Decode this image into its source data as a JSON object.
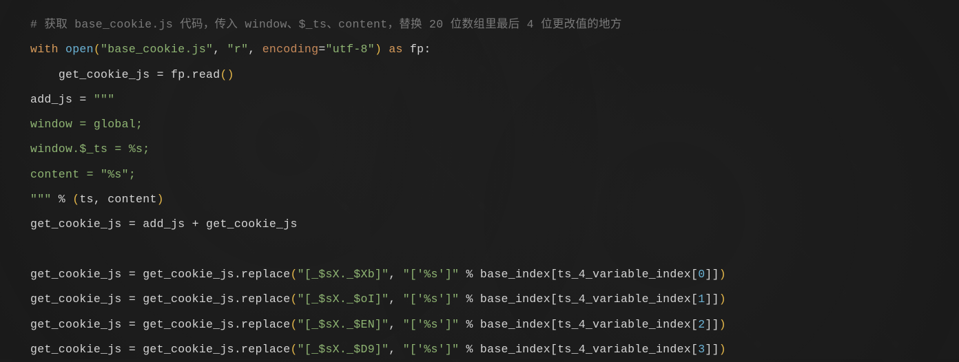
{
  "code": {
    "line1": {
      "comment": "# 获取 base_cookie.js 代码，传入 window、$_ts、content，替换 20 位数组里最后 4 位更改值的地方"
    },
    "line2": {
      "with": "with",
      "open": "open",
      "lparen": "(",
      "arg1": "\"base_cookie.js\"",
      "comma1": ", ",
      "arg2": "\"r\"",
      "comma2": ", ",
      "encparam": "encoding",
      "eq": "=",
      "encval": "\"utf-8\"",
      "rparen": ")",
      "as": " as ",
      "fp": "fp:"
    },
    "line3": {
      "indent": "    ",
      "var": "get_cookie_js = fp.read",
      "lparen": "(",
      "rparen": ")"
    },
    "line4": {
      "text": "add_js = ",
      "str": "\"\"\""
    },
    "line5": {
      "text": "window = global;"
    },
    "line6": {
      "text": "window.$_ts = %s;"
    },
    "line7": {
      "text": "content = \"%s\";"
    },
    "line8": {
      "str": "\"\"\"",
      "pct": " % ",
      "lparen": "(",
      "arg1": "ts",
      "comma": ", ",
      "arg2": "content",
      "rparen": ")"
    },
    "line9": {
      "text": "get_cookie_js = add_js + get_cookie_js"
    },
    "line10": "",
    "line11": {
      "prefix": "get_cookie_js = get_cookie_js.replace",
      "lparen": "(",
      "arg1": "\"[_$sX._$Xb]\"",
      "comma": ", ",
      "arg2": "\"['%s']\"",
      "mid": " % base_index[ts_4_variable_index[",
      "idx": "0",
      "suffix": "]]",
      "rparen": ")"
    },
    "line12": {
      "prefix": "get_cookie_js = get_cookie_js.replace",
      "lparen": "(",
      "arg1": "\"[_$sX._$oI]\"",
      "comma": ", ",
      "arg2": "\"['%s']\"",
      "mid": " % base_index[ts_4_variable_index[",
      "idx": "1",
      "suffix": "]]",
      "rparen": ")"
    },
    "line13": {
      "prefix": "get_cookie_js = get_cookie_js.replace",
      "lparen": "(",
      "arg1": "\"[_$sX._$EN]\"",
      "comma": ", ",
      "arg2": "\"['%s']\"",
      "mid": " % base_index[ts_4_variable_index[",
      "idx": "2",
      "suffix": "]]",
      "rparen": ")"
    },
    "line14": {
      "prefix": "get_cookie_js = get_cookie_js.replace",
      "lparen": "(",
      "arg1": "\"[_$sX._$D9]\"",
      "comma": ", ",
      "arg2": "\"['%s']\"",
      "mid": " % base_index[ts_4_variable_index[",
      "idx": "3",
      "suffix": "]]",
      "rparen": ")"
    }
  }
}
